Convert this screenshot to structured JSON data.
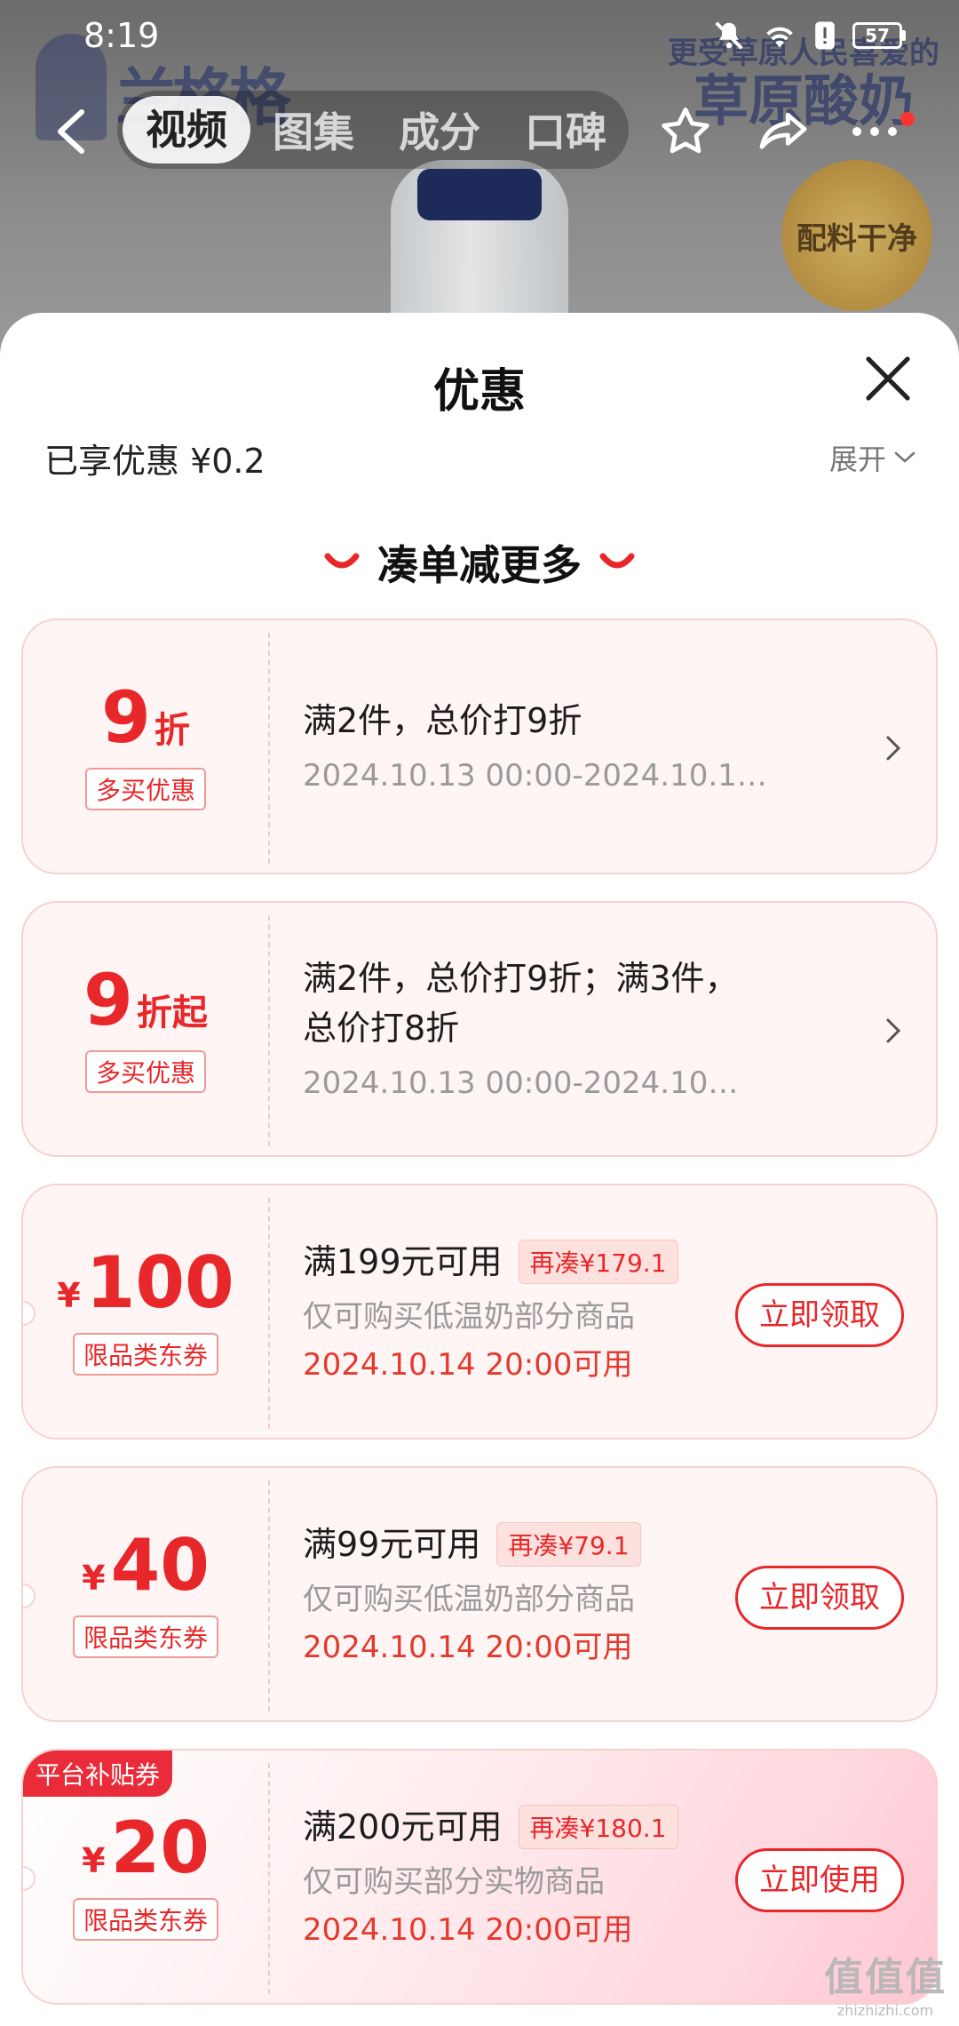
{
  "status_bar": {
    "time": "8:19",
    "battery": "57"
  },
  "background": {
    "brand_text": "兰格格",
    "slogan_line1": "更受草原人民喜爱的",
    "slogan_line2": "草原酸奶",
    "badge_text": "配料干净"
  },
  "nav": {
    "tabs": [
      {
        "label": "视频",
        "active": true
      },
      {
        "label": "图集",
        "active": false
      },
      {
        "label": "成分",
        "active": false
      },
      {
        "label": "口碑",
        "active": false
      }
    ]
  },
  "sheet": {
    "title": "优惠",
    "enjoyed": "已享优惠 ¥0.2",
    "expand_label": "展开",
    "section_title": "凑单减更多"
  },
  "cards": [
    {
      "kind": "discount",
      "amount": "9",
      "unit": "折",
      "tag": "多买优惠",
      "line1": "满2件，总价打9折",
      "line2": "2024.10.13 00:00-2024.10.14..."
    },
    {
      "kind": "discount",
      "amount": "9",
      "unit": "折起",
      "tag": "多买优惠",
      "line1": "满2件，总价打9折；满3件，总价打8折",
      "line2": "2024.10.13 00:00-2024.10.14..."
    },
    {
      "kind": "coupon",
      "currency": "¥",
      "amount": "100",
      "tag": "限品类东券",
      "line1": "满199元可用",
      "pill": "再凑¥179.1",
      "line2": "仅可购买低温奶部分商品",
      "line3": "2024.10.14 20:00可用",
      "button": "立即领取"
    },
    {
      "kind": "coupon",
      "currency": "¥",
      "amount": "40",
      "tag": "限品类东券",
      "line1": "满99元可用",
      "pill": "再凑¥79.1",
      "line2": "仅可购买低温奶部分商品",
      "line3": "2024.10.14 20:00可用",
      "button": "立即领取"
    },
    {
      "kind": "platform",
      "platform_tag": "平台补贴券",
      "currency": "¥",
      "amount": "20",
      "tag": "限品类东券",
      "line1": "满200元可用",
      "pill": "再凑¥180.1",
      "line2": "仅可购买部分实物商品",
      "line3": "2024.10.14 20:00可用",
      "button": "立即使用"
    }
  ],
  "watermark": {
    "main": "值值值",
    "sub": "zhizhizhi.com"
  },
  "colors": {
    "accent": "#e8272a",
    "card_bg": "#fff5f4",
    "card_border": "#f5d2cf"
  }
}
